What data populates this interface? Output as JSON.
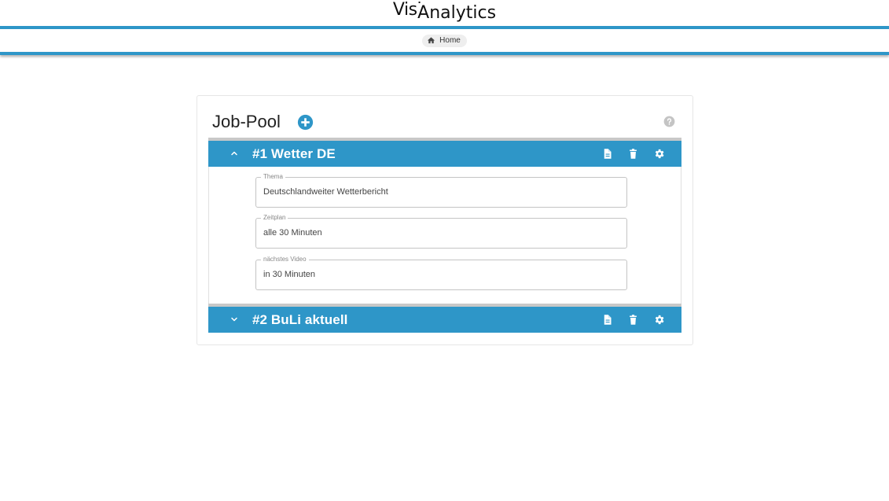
{
  "app": {
    "logo_part1": "Visi",
    "logo_part2": "Analytics"
  },
  "breadcrumb": {
    "home_label": "Home",
    "home_icon": "home-icon"
  },
  "page": {
    "title": "Job-Pool",
    "add_icon": "plus-circle-icon",
    "help_icon": "question-circle-icon"
  },
  "jobs": [
    {
      "title": "#1 Wetter DE",
      "expanded": true,
      "icons": [
        "document-icon",
        "trash-icon",
        "gear-icon"
      ],
      "fields": [
        {
          "label": "Thema",
          "value": "Deutschlandweiter Wetterbericht"
        },
        {
          "label": "Zeitplan",
          "value": "alle 30 Minuten"
        },
        {
          "label": "nächstes Video",
          "value": "in 30 Minuten"
        }
      ]
    },
    {
      "title": "#2 BuLi aktuell",
      "expanded": false,
      "icons": [
        "document-icon",
        "trash-icon",
        "gear-icon"
      ]
    }
  ],
  "colors": {
    "accent": "#2e96c8",
    "header_border": "#c8c8c8"
  }
}
